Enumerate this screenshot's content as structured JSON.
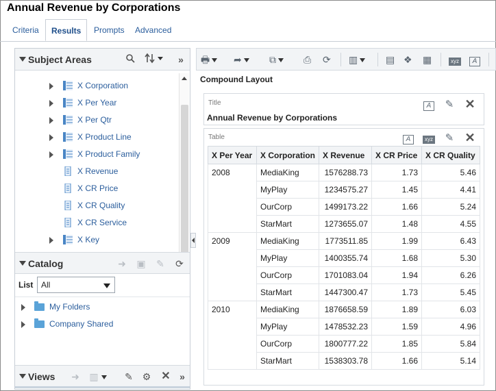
{
  "app": {
    "title": "Annual Revenue by Corporations"
  },
  "tabs": [
    {
      "label": "Criteria",
      "active": false
    },
    {
      "label": "Results",
      "active": true
    },
    {
      "label": "Prompts",
      "active": false
    },
    {
      "label": "Advanced",
      "active": false
    }
  ],
  "subject_areas": {
    "title": "Subject Areas",
    "icons": [
      "search-icon",
      "sort-icon",
      "collapse-pane-icon"
    ],
    "items": [
      {
        "label": "X Corporation",
        "kind": "folder"
      },
      {
        "label": "X Per Year",
        "kind": "folder"
      },
      {
        "label": "X Per Qtr",
        "kind": "folder"
      },
      {
        "label": "X Product Line",
        "kind": "folder"
      },
      {
        "label": "X Product Family",
        "kind": "folder"
      },
      {
        "label": "X Revenue",
        "kind": "measure"
      },
      {
        "label": "X CR Price",
        "kind": "measure"
      },
      {
        "label": "X CR Quality",
        "kind": "measure"
      },
      {
        "label": "X CR Service",
        "kind": "measure"
      },
      {
        "label": "X Key",
        "kind": "folder"
      }
    ]
  },
  "catalog": {
    "title": "Catalog",
    "list_label": "List",
    "list_value": "All",
    "folders": [
      "My Folders",
      "Company Shared"
    ]
  },
  "views": {
    "title": "Views"
  },
  "main": {
    "compound_label": "Compound Layout",
    "title_view": {
      "label": "Title",
      "text": "Annual Revenue by Corporations"
    },
    "table_view": {
      "label": "Table",
      "columns": [
        "X Per Year",
        "X Corporation",
        "X Revenue",
        "X CR Price",
        "X CR Quality"
      ],
      "groups": [
        {
          "year": "2008",
          "rows": [
            [
              "MediaKing",
              "1576288.73",
              "1.73",
              "5.46"
            ],
            [
              "MyPlay",
              "1234575.27",
              "1.45",
              "4.41"
            ],
            [
              "OurCorp",
              "1499173.22",
              "1.66",
              "5.24"
            ],
            [
              "StarMart",
              "1273655.07",
              "1.48",
              "4.55"
            ]
          ]
        },
        {
          "year": "2009",
          "rows": [
            [
              "MediaKing",
              "1773511.85",
              "1.99",
              "6.43"
            ],
            [
              "MyPlay",
              "1400355.74",
              "1.68",
              "5.30"
            ],
            [
              "OurCorp",
              "1701083.04",
              "1.94",
              "6.26"
            ],
            [
              "StarMart",
              "1447300.47",
              "1.73",
              "5.45"
            ]
          ]
        },
        {
          "year": "2010",
          "rows": [
            [
              "MediaKing",
              "1876658.59",
              "1.89",
              "6.03"
            ],
            [
              "MyPlay",
              "1478532.23",
              "1.59",
              "4.96"
            ],
            [
              "OurCorp",
              "1800777.22",
              "1.85",
              "5.84"
            ],
            [
              "StarMart",
              "1538303.78",
              "1.66",
              "5.14"
            ]
          ]
        }
      ]
    }
  },
  "colors": {
    "link": "#2a5d9c",
    "panel_header": "#f2f4f6",
    "border": "#d5dae0"
  }
}
